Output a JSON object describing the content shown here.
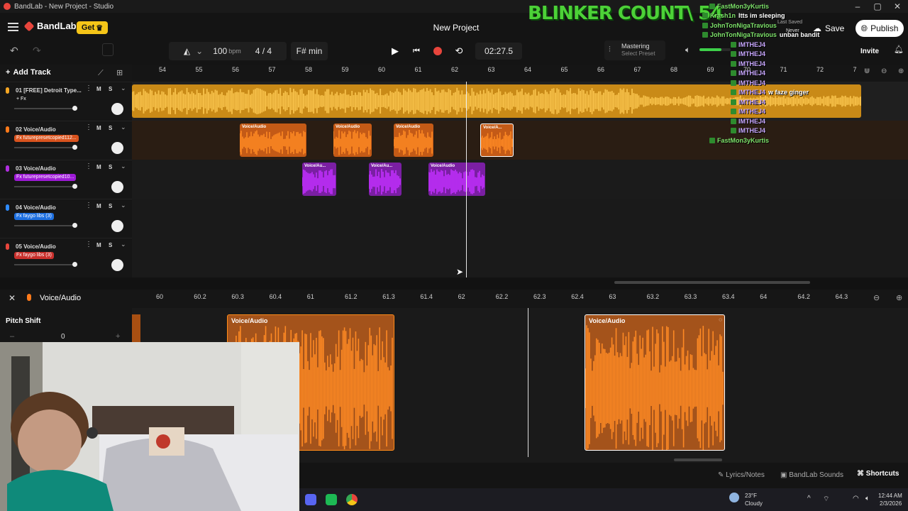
{
  "window": {
    "title": "BandLab - New Project - Studio"
  },
  "header": {
    "logo": "BandLab",
    "get_label": "Get",
    "project_title": "New Project",
    "save_label": "Save",
    "publish_label": "Publish",
    "invite_label": "Invite"
  },
  "overlay": {
    "banner": "BLINKER COUNT\\ 54",
    "chat": [
      {
        "user": "FastMon3yKurtis",
        "msg": "",
        "purple": false
      },
      {
        "user": "Krash1n",
        "msg": "Itts im sleeping",
        "purple": false
      },
      {
        "user": "JohnTonNigaTravious",
        "msg": "",
        "purple": false
      },
      {
        "user": "JohnTonNigaTravious",
        "msg": "unban bandit",
        "purple": false
      },
      {
        "user": "IMTHEJ4",
        "msg": "",
        "purple": true
      },
      {
        "user": "IMTHEJ4",
        "msg": "",
        "purple": true
      },
      {
        "user": "IMTHEJ4",
        "msg": "",
        "purple": true
      },
      {
        "user": "IMTHEJ4",
        "msg": "",
        "purple": true
      },
      {
        "user": "IMTHEJ4",
        "msg": "",
        "purple": true
      },
      {
        "user": "IMTHEJ4",
        "msg": "w faze ginger",
        "purple": true
      },
      {
        "user": "IMTHEJ4",
        "msg": "",
        "purple": true
      },
      {
        "user": "IMTHEJ4",
        "msg": "",
        "purple": true
      },
      {
        "user": "IMTHEJ4",
        "msg": "",
        "purple": true
      },
      {
        "user": "IMTHEJ4",
        "msg": "",
        "purple": true
      },
      {
        "user": "FastMon3yKurtis",
        "msg": "",
        "purple": false
      }
    ],
    "never": "Never",
    "last_saved": "Last Saved"
  },
  "toolbar": {
    "tempo": "100",
    "tempo_unit": "bpm",
    "time_signature": "4 / 4",
    "key": "F# min",
    "timecode": "02:27.5",
    "mastering_label": "Mastering",
    "mastering_preset": "Select Preset"
  },
  "tracks_panel": {
    "add_track_label": "Add Track",
    "tracks": [
      {
        "num": "01",
        "name": "[FREE] Detroit Type...",
        "fx": "+ Fx",
        "color": "#f5a623",
        "fx_bg": "transparent"
      },
      {
        "num": "02",
        "name": "Voice/Audio",
        "fx": "Fx futurepresetcopied112...",
        "color": "#ff7a1a",
        "fx_bg": "#d9531e"
      },
      {
        "num": "03",
        "name": "Voice/Audio",
        "fx": "Fx futurepresetcopied10...",
        "color": "#b02ee0",
        "fx_bg": "#9d1ad6"
      },
      {
        "num": "04",
        "name": "Voice/Audio",
        "fx": "Fx faygo libs (3)",
        "color": "#2e8bff",
        "fx_bg": "#1d6fe0"
      },
      {
        "num": "05",
        "name": "Voice/Audio",
        "fx": "Fx faygo libs (3)",
        "color": "#e8453c",
        "fx_bg": "#c9302c"
      }
    ],
    "mute": "M",
    "solo": "S"
  },
  "ruler": [
    "54",
    "55",
    "56",
    "57",
    "58",
    "59",
    "60",
    "61",
    "62",
    "63",
    "64",
    "65",
    "66",
    "67",
    "68",
    "69",
    "70",
    "71",
    "72",
    "7"
  ],
  "clips": {
    "label": "Voice/Audio",
    "short_label": "Voice/Au...",
    "short_label2": "Voice/A..."
  },
  "editor": {
    "track_name": "Voice/Audio",
    "pitch_label": "Pitch Shift",
    "pitch_value": "0",
    "ruler": [
      "60",
      "60.2",
      "60.3",
      "60.4",
      "61",
      "61.2",
      "61.3",
      "61.4",
      "62",
      "62.2",
      "62.3",
      "62.4",
      "63",
      "63.2",
      "63.3",
      "63.4",
      "64",
      "64.2",
      "64.3"
    ],
    "clip_label": "Voice/Audio"
  },
  "footer": {
    "lyrics": "Lyrics/Notes",
    "sounds": "BandLab Sounds",
    "shortcuts": "Shortcuts"
  },
  "taskbar": {
    "temp": "23°F",
    "weather": "Cloudy",
    "time": "12:44 AM",
    "date": "2/3/2026"
  },
  "colors": {
    "orange": "#ff7a1a",
    "amber": "#f5a623",
    "purple": "#b02ee0",
    "accent_red": "#e8453c"
  }
}
